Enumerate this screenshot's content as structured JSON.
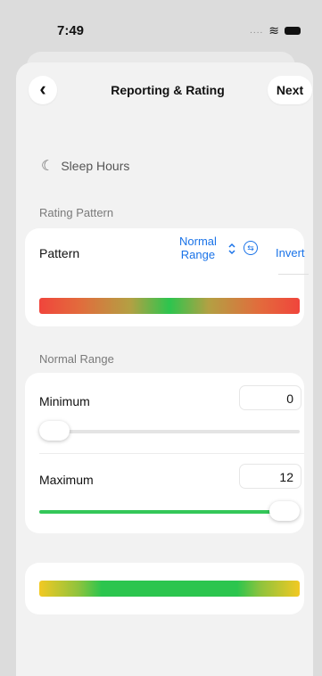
{
  "status_bar": {
    "time": "7:49",
    "signal_dots": "....",
    "wifi_glyph": "≋"
  },
  "nav": {
    "title": "Reporting & Rating",
    "back_glyph": "‹",
    "next_label": "Next"
  },
  "metric": {
    "icon_glyph": "☾",
    "label": "Sleep Hours"
  },
  "rating_pattern": {
    "section_label": "Rating Pattern",
    "pattern_label": "Pattern",
    "selected_line1": "Normal",
    "selected_line2": "Range",
    "chevron_glyph": "⌃⌄",
    "invert_glyph": "⇆",
    "invert_label": "Invert"
  },
  "normal_range": {
    "section_label": "Normal Range",
    "minimum_label": "Minimum",
    "minimum_value": "0",
    "minimum_fraction": 0.0,
    "maximum_label": "Maximum",
    "maximum_value": "12",
    "maximum_fraction": 1.0
  },
  "colors": {
    "accent": "#1a73e8",
    "green": "#34c759",
    "red": "#f0453c",
    "yellow": "#f2c923"
  }
}
